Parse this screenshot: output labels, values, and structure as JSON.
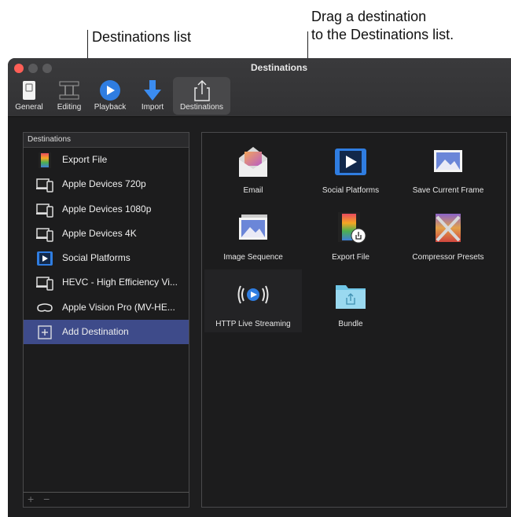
{
  "callouts": {
    "left": "Destinations list",
    "right_line1": "Drag a destination",
    "right_line2": "to the Destinations list."
  },
  "window": {
    "title": "Destinations"
  },
  "toolbar": [
    {
      "label": "General",
      "icon": "general-switch-icon"
    },
    {
      "label": "Editing",
      "icon": "film-strip-icon"
    },
    {
      "label": "Playback",
      "icon": "play-icon"
    },
    {
      "label": "Import",
      "icon": "download-arrow-icon"
    },
    {
      "label": "Destinations",
      "icon": "share-icon",
      "active": true
    }
  ],
  "destinations_list": {
    "header": "Destinations",
    "items": [
      {
        "label": "Export File",
        "icon": "film-icon"
      },
      {
        "label": "Apple Devices 720p",
        "icon": "devices-icon"
      },
      {
        "label": "Apple Devices 1080p",
        "icon": "devices-icon"
      },
      {
        "label": "Apple Devices 4K",
        "icon": "devices-icon"
      },
      {
        "label": "Social Platforms",
        "icon": "social-play-icon"
      },
      {
        "label": "HEVC - High Efficiency Vi...",
        "icon": "devices-icon"
      },
      {
        "label": "Apple Vision Pro (MV-HE...",
        "icon": "vision-pro-icon"
      },
      {
        "label": "Add Destination",
        "icon": "add-box-icon",
        "selected": true
      }
    ],
    "footer_add": "+",
    "footer_remove": "−"
  },
  "destination_templates": [
    {
      "label": "Email",
      "icon": "email-icon"
    },
    {
      "label": "Social Platforms",
      "icon": "social-platforms-icon"
    },
    {
      "label": "Save Current Frame",
      "icon": "save-frame-icon"
    },
    {
      "label": "Image Sequence",
      "icon": "image-sequence-icon"
    },
    {
      "label": "Export File",
      "icon": "export-file-icon"
    },
    {
      "label": "Compressor Presets",
      "icon": "compressor-icon"
    },
    {
      "label": "HTTP Live Streaming",
      "icon": "live-streaming-icon"
    },
    {
      "label": "Bundle",
      "icon": "bundle-folder-icon"
    }
  ],
  "colors": {
    "selection": "#3e4b8a",
    "accent_blue": "#2f7de1",
    "close_button": "#fe5f57"
  }
}
